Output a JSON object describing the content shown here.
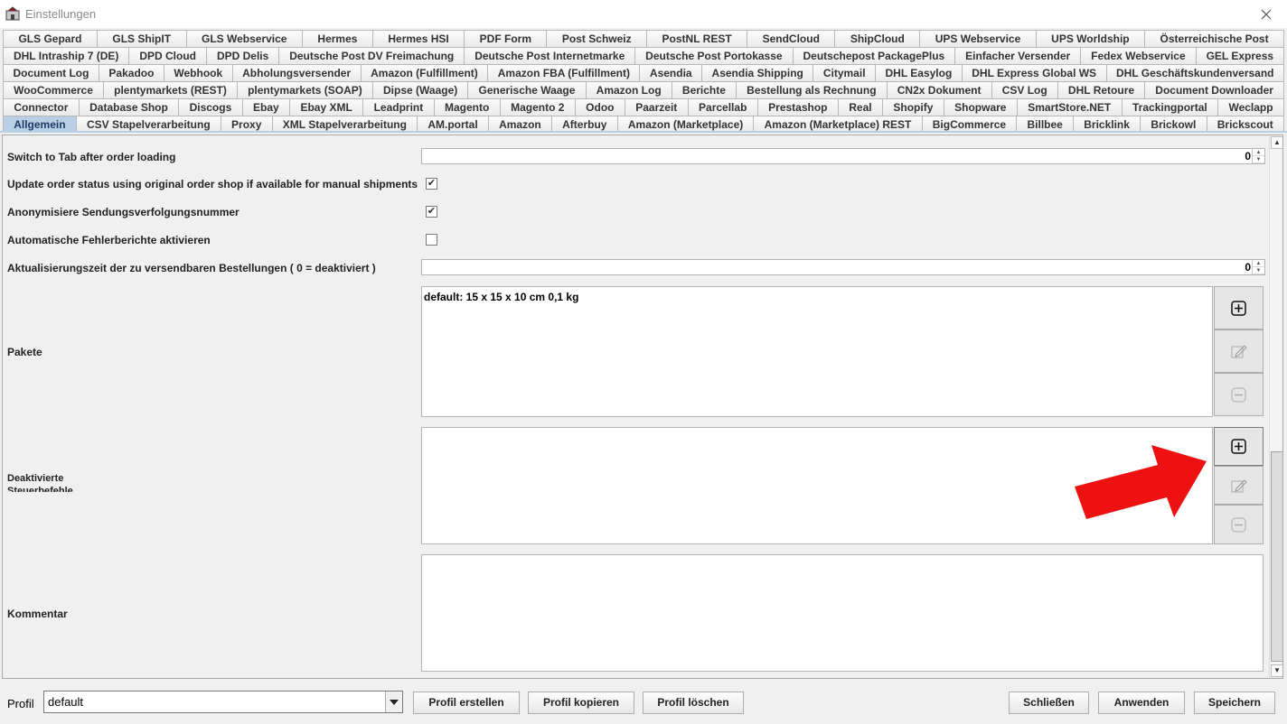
{
  "window": {
    "title": "Einstellungen"
  },
  "tabs": [
    [
      "GLS Gepard",
      "GLS ShipIT",
      "GLS Webservice",
      "Hermes",
      "Hermes HSI",
      "PDF Form",
      "Post Schweiz",
      "PostNL REST",
      "SendCloud",
      "ShipCloud",
      "UPS Webservice",
      "UPS Worldship",
      "Österreichische Post"
    ],
    [
      "DHL Intraship 7 (DE)",
      "DPD Cloud",
      "DPD Delis",
      "Deutsche Post DV Freimachung",
      "Deutsche Post Internetmarke",
      "Deutsche Post Portokasse",
      "Deutschepost PackagePlus",
      "Einfacher Versender",
      "Fedex Webservice",
      "GEL Express"
    ],
    [
      "Document Log",
      "Pakadoo",
      "Webhook",
      "Abholungsversender",
      "Amazon (Fulfillment)",
      "Amazon FBA (Fulfillment)",
      "Asendia",
      "Asendia Shipping",
      "Citymail",
      "DHL Easylog",
      "DHL Express Global WS",
      "DHL Geschäftskundenversand"
    ],
    [
      "WooCommerce",
      "plentymarkets (REST)",
      "plentymarkets (SOAP)",
      "Dipse (Waage)",
      "Generische Waage",
      "Amazon Log",
      "Berichte",
      "Bestellung als Rechnung",
      "CN2x Dokument",
      "CSV Log",
      "DHL Retoure",
      "Document Downloader"
    ],
    [
      "Connector",
      "Database Shop",
      "Discogs",
      "Ebay",
      "Ebay XML",
      "Leadprint",
      "Magento",
      "Magento 2",
      "Odoo",
      "Paarzeit",
      "Parcellab",
      "Prestashop",
      "Real",
      "Shopify",
      "Shopware",
      "SmartStore.NET",
      "Trackingportal",
      "Weclapp"
    ],
    [
      "Allgemein",
      "CSV Stapelverarbeitung",
      "Proxy",
      "XML Stapelverarbeitung",
      "AM.portal",
      "Amazon",
      "Afterbuy",
      "Amazon (Marketplace)",
      "Amazon (Marketplace) REST",
      "BigCommerce",
      "Billbee",
      "Bricklink",
      "Brickowl",
      "Brickscout"
    ]
  ],
  "selected_tab": "Allgemein",
  "settings": {
    "switch_tab_label": "Switch to Tab after order loading",
    "switch_tab_value": "0",
    "update_status_label": "Update order status using original order shop if available for manual shipments",
    "update_status_checked": true,
    "anonymize_label": "Anonymisiere Sendungsverfolgungsnummer",
    "anonymize_checked": true,
    "error_reports_label": "Automatische Fehlerberichte aktivieren",
    "error_reports_checked": false,
    "refresh_label": "Aktualisierungszeit der zu versendbaren Bestellungen ( 0 = deaktiviert )",
    "refresh_value": "0",
    "pakete_label": "Pakete",
    "pakete_item": "default: 15 x 15 x 10 cm 0,1 kg",
    "deact_label_1": "Deaktivierte",
    "deact_label_2": "Steuerbefehle",
    "kommentar_label": "Kommentar"
  },
  "bottom": {
    "profil_label": "Profil",
    "profil_value": "default",
    "create": "Profil erstellen",
    "copy": "Profil kopieren",
    "delete": "Profil löschen",
    "close": "Schließen",
    "apply": "Anwenden",
    "save": "Speichern"
  },
  "icons": {
    "add": "plus-box-icon",
    "edit": "pencil-icon",
    "remove": "minus-circle-icon",
    "annotation": "red-arrow-icon"
  },
  "colors": {
    "selected_tab": "#b8cfe5",
    "arrow": "#ee1111"
  }
}
